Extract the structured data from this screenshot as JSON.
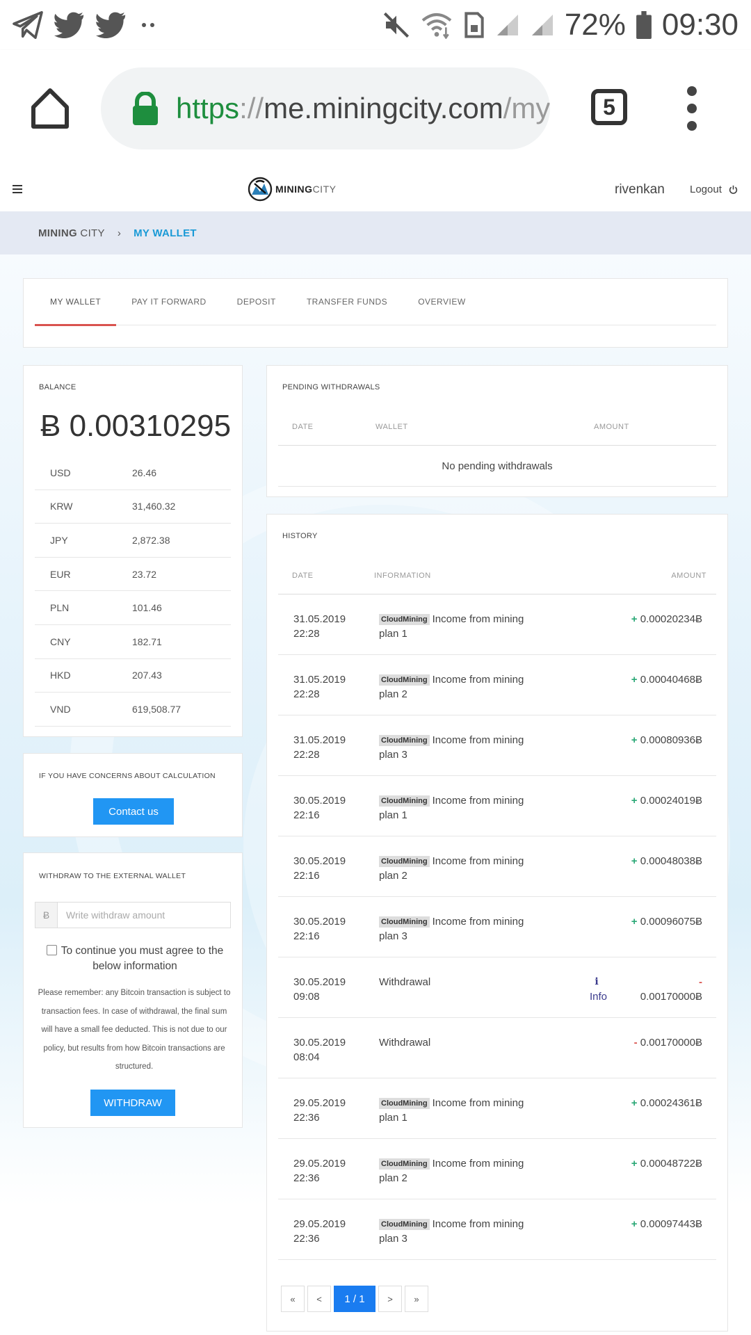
{
  "status_bar": {
    "battery_percent": "72%",
    "time": "09:30",
    "icons": [
      "telegram-icon",
      "twitter-icon",
      "twitter-icon",
      "more-dots-icon",
      "mute-icon",
      "wifi-icon",
      "sim-icon",
      "signal-icon",
      "signal-icon",
      "battery-icon"
    ]
  },
  "browser": {
    "url_scheme": "https",
    "url_sep": "://",
    "url_host": "me.miningcity.com",
    "url_rest": "/my",
    "tab_count": "5"
  },
  "header": {
    "logo_bold": "MINING",
    "logo_light": "CITY",
    "username": "rivenkan",
    "logout_label": "Logout"
  },
  "breadcrumb": {
    "root_bold": "MINING",
    "root_light": " CITY",
    "separator": "›",
    "current": "MY WALLET"
  },
  "tabs": [
    {
      "label": "MY WALLET",
      "active": true
    },
    {
      "label": "PAY IT FORWARD"
    },
    {
      "label": "DEPOSIT"
    },
    {
      "label": "TRANSFER FUNDS"
    },
    {
      "label": "OVERVIEW"
    }
  ],
  "balance": {
    "title": "BALANCE",
    "amount": "Ƀ 0.00310295",
    "currencies": [
      {
        "code": "USD",
        "value": "26.46"
      },
      {
        "code": "KRW",
        "value": "31,460.32"
      },
      {
        "code": "JPY",
        "value": "2,872.38"
      },
      {
        "code": "EUR",
        "value": "23.72"
      },
      {
        "code": "PLN",
        "value": "101.46"
      },
      {
        "code": "CNY",
        "value": "182.71"
      },
      {
        "code": "HKD",
        "value": "207.43"
      },
      {
        "code": "VND",
        "value": "619,508.77"
      }
    ]
  },
  "concerns": {
    "title": "IF YOU HAVE CONCERNS ABOUT CALCULATION",
    "button": "Contact us"
  },
  "withdraw": {
    "title": "WITHDRAW TO THE EXTERNAL WALLET",
    "addon": "Ƀ",
    "placeholder": "Write withdraw amount",
    "agree_text": "To continue you must agree to the below information",
    "note": "Please remember: any Bitcoin transaction is subject to transaction fees. In case of withdrawal, the final sum will have a small fee deducted. This is not due to our policy, but results from how Bitcoin transactions are structured.",
    "button": "WITHDRAW"
  },
  "pending": {
    "title": "PENDING WITHDRAWALS",
    "col_date": "DATE",
    "col_wallet": "WALLET",
    "col_amount": "AMOUNT",
    "empty_text": "No pending withdrawals"
  },
  "history": {
    "title": "HISTORY",
    "col_date": "DATE",
    "col_info": "INFORMATION",
    "col_amount": "AMOUNT",
    "info_link": "Info",
    "rows": [
      {
        "date": "31.05.2019",
        "time": "22:28",
        "tag": "CloudMining",
        "info": "Income from mining plan 1",
        "sign": "+",
        "amount": "0.00020234Ƀ"
      },
      {
        "date": "31.05.2019",
        "time": "22:28",
        "tag": "CloudMining",
        "info": "Income from mining plan 2",
        "sign": "+",
        "amount": "0.00040468Ƀ"
      },
      {
        "date": "31.05.2019",
        "time": "22:28",
        "tag": "CloudMining",
        "info": "Income from mining plan 3",
        "sign": "+",
        "amount": "0.00080936Ƀ"
      },
      {
        "date": "30.05.2019",
        "time": "22:16",
        "tag": "CloudMining",
        "info": "Income from mining plan 1",
        "sign": "+",
        "amount": "0.00024019Ƀ"
      },
      {
        "date": "30.05.2019",
        "time": "22:16",
        "tag": "CloudMining",
        "info": "Income from mining plan 2",
        "sign": "+",
        "amount": "0.00048038Ƀ"
      },
      {
        "date": "30.05.2019",
        "time": "22:16",
        "tag": "CloudMining",
        "info": "Income from mining plan 3",
        "sign": "+",
        "amount": "0.00096075Ƀ"
      },
      {
        "date": "30.05.2019",
        "time": "09:08",
        "tag": "",
        "info": "Withdrawal",
        "sign": "-",
        "amount": "0.00170000Ƀ",
        "has_info": true
      },
      {
        "date": "30.05.2019",
        "time": "08:04",
        "tag": "",
        "info": "Withdrawal",
        "sign": "-",
        "amount": "0.00170000Ƀ"
      },
      {
        "date": "29.05.2019",
        "time": "22:36",
        "tag": "CloudMining",
        "info": "Income from mining plan 1",
        "sign": "+",
        "amount": "0.00024361Ƀ"
      },
      {
        "date": "29.05.2019",
        "time": "22:36",
        "tag": "CloudMining",
        "info": "Income from mining plan 2",
        "sign": "+",
        "amount": "0.00048722Ƀ"
      },
      {
        "date": "29.05.2019",
        "time": "22:36",
        "tag": "CloudMining",
        "info": "Income from mining plan 3",
        "sign": "+",
        "amount": "0.00097443Ƀ"
      }
    ]
  },
  "pagination": {
    "first": "«",
    "prev": "<",
    "current": "1 / 1",
    "next": ">",
    "last": "»"
  },
  "colors": {
    "accent_blue": "#2196f3",
    "breadcrumb_active": "#1a9ad6",
    "tab_underline": "#d9534f",
    "income_green": "#2aa876",
    "outflow_red": "#d9534f",
    "url_green": "#1e8e3e"
  }
}
